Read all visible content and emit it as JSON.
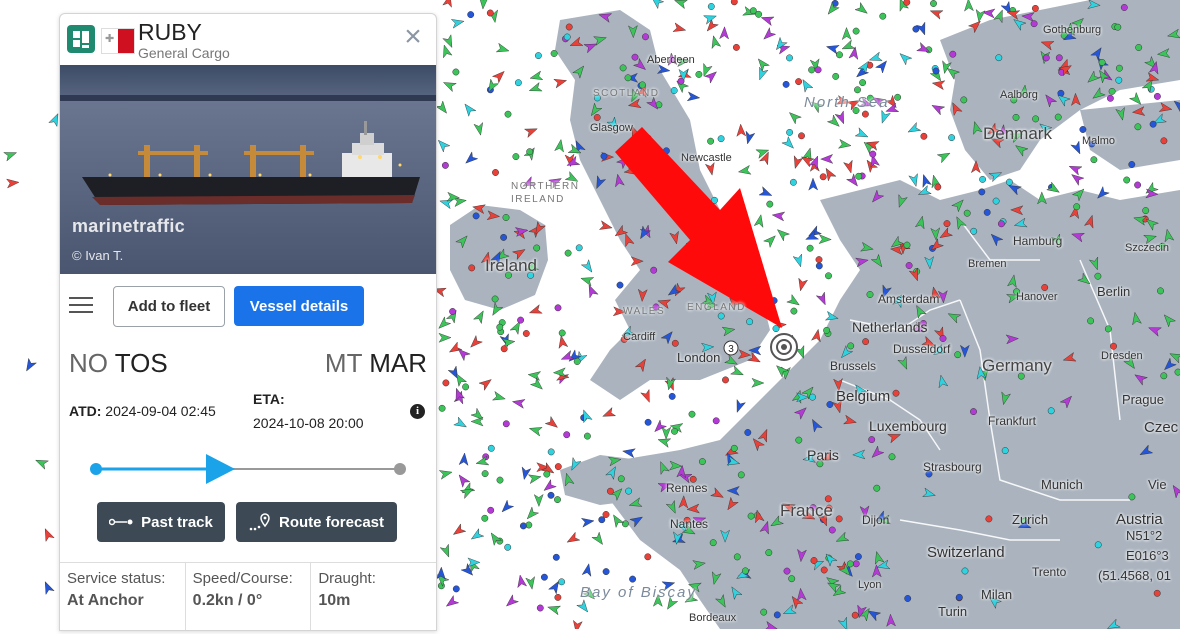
{
  "vessel": {
    "name": "RUBY",
    "type": "General Cargo",
    "photo_watermark": "marinetraffic",
    "photo_credit": "© Ivan T.",
    "flag_icon": "malta-flag-icon"
  },
  "actions": {
    "add_to_fleet": "Add to fleet",
    "vessel_details": "Vessel details"
  },
  "voyage": {
    "departure_cc": "NO",
    "departure_port": "TOS",
    "arrival_cc": "MT",
    "arrival_port": "MAR",
    "atd_label": "ATD:",
    "atd_value": "2024-09-04 02:45",
    "eta_label": "ETA:",
    "eta_value": "2024-10-08 20:00"
  },
  "tracks": {
    "past_track": "Past track",
    "route_forecast": "Route forecast"
  },
  "status": {
    "service_label": "Service status:",
    "service_value": "At Anchor",
    "speed_label": "Speed/Course:",
    "speed_value": "0.2kn / 0°",
    "draught_label": "Draught:",
    "draught_value": "10m"
  },
  "map": {
    "countries": [
      "Ireland",
      "Denmark",
      "Germany",
      "Netherlands",
      "Belgium",
      "Luxembourg",
      "France",
      "Switzerland",
      "Austria",
      "Czec"
    ],
    "cities": [
      "London",
      "Cardiff",
      "Amsterdam",
      "Hamburg",
      "Bremen",
      "Hanover",
      "Berlin",
      "Dresden",
      "Prague",
      "Frankfurt",
      "Munich",
      "Strasbourg",
      "Zurich",
      "Paris",
      "Rennes",
      "Nantes",
      "Dijon",
      "Lyon",
      "Milan",
      "Turin",
      "Trento",
      "Aberdeen",
      "Glasgow",
      "Newcastle",
      "Aalborg",
      "Gothenburg",
      "Malmo",
      "Szczecin",
      "Brussels",
      "Dusseldorf",
      "Bordeaux",
      "Vie"
    ],
    "seas": [
      "North Sea",
      "Bay of Biscay"
    ],
    "regions": [
      "SCOTLAND",
      "ENGLAND",
      "WALES",
      "NORTHERN IRELAND"
    ],
    "coords": [
      "N51°2",
      "E016°3",
      "(51.4568, 01"
    ],
    "cluster_count": "3",
    "colors": {
      "green": "#3cc45a",
      "red": "#e8413a",
      "cyan": "#2fd3e0",
      "blue": "#2556d8",
      "purple": "#b43ad6",
      "land": "#ffffff",
      "water": "#aab3be"
    }
  }
}
